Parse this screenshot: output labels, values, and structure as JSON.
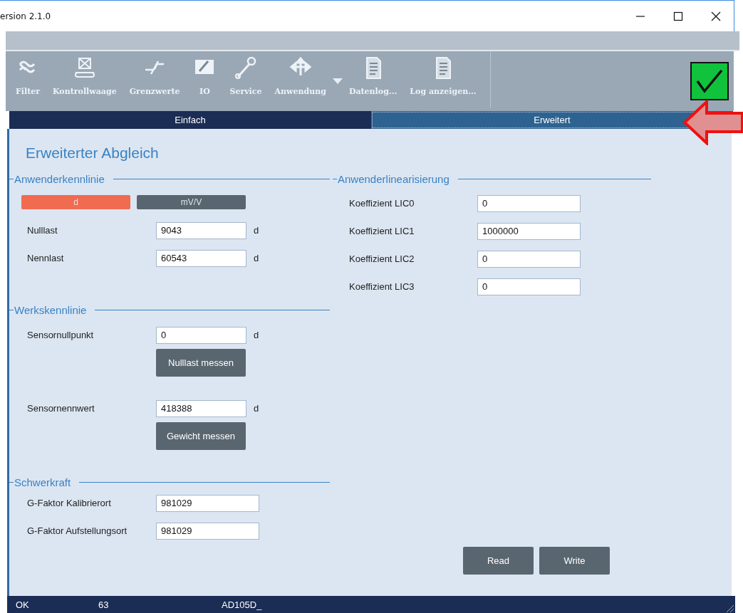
{
  "window": {
    "title": "ersion 2.1.0"
  },
  "toolbar": [
    {
      "label": "Filter",
      "kind": "filter"
    },
    {
      "label": "Kontrollwaage",
      "kind": "scale"
    },
    {
      "label": "Grenzwerte",
      "kind": "limit"
    },
    {
      "label": "IO",
      "kind": "io"
    },
    {
      "label": "Service",
      "kind": "wrench"
    },
    {
      "label": "Anwendung",
      "kind": "arrows"
    },
    {
      "label": "Datenlog...",
      "kind": "datalog"
    },
    {
      "label": "Log anzeigen...",
      "kind": "log"
    }
  ],
  "status_ok": true,
  "tabs": [
    {
      "label": "Einfach",
      "selected": false
    },
    {
      "label": "Erweitert",
      "selected": true
    }
  ],
  "heading": "Erweiterter Abgleich",
  "anwenderkennlinie": {
    "title": "Anwenderkennlinie",
    "units": [
      {
        "label": "d",
        "selected": true
      },
      {
        "label": "mV/V",
        "selected": false
      }
    ],
    "fields": [
      {
        "label": "Nulllast",
        "value": "9043",
        "unit": "d"
      },
      {
        "label": "Nennlast",
        "value": "60543",
        "unit": "d"
      }
    ]
  },
  "werkskennlinie": {
    "title": "Werkskennlinie",
    "fields": [
      {
        "label": "Sensornullpunkt",
        "value": "0",
        "unit": "d",
        "button": "Nulllast messen"
      },
      {
        "label": "Sensornennwert",
        "value": "418388",
        "unit": "d",
        "button": "Gewicht messen"
      }
    ]
  },
  "schwerkraft": {
    "title": "Schwerkraft",
    "fields": [
      {
        "label": "G-Faktor Kalibrierort",
        "value": "981029"
      },
      {
        "label": "G-Faktor Aufstellungsort",
        "value": "981029"
      }
    ]
  },
  "anwenderlinearisierung": {
    "title": "Anwenderlinearisierung",
    "fields": [
      {
        "label": "Koeffizient LIC0",
        "value": "0"
      },
      {
        "label": "Koeffizient LIC1",
        "value": "1000000"
      },
      {
        "label": "Koeffizient LIC2",
        "value": "0"
      },
      {
        "label": "Koeffizient LIC3",
        "value": "0"
      }
    ]
  },
  "buttons": [
    "Read",
    "Write"
  ],
  "status_bar": [
    "OK",
    "63",
    "AD105D_"
  ]
}
